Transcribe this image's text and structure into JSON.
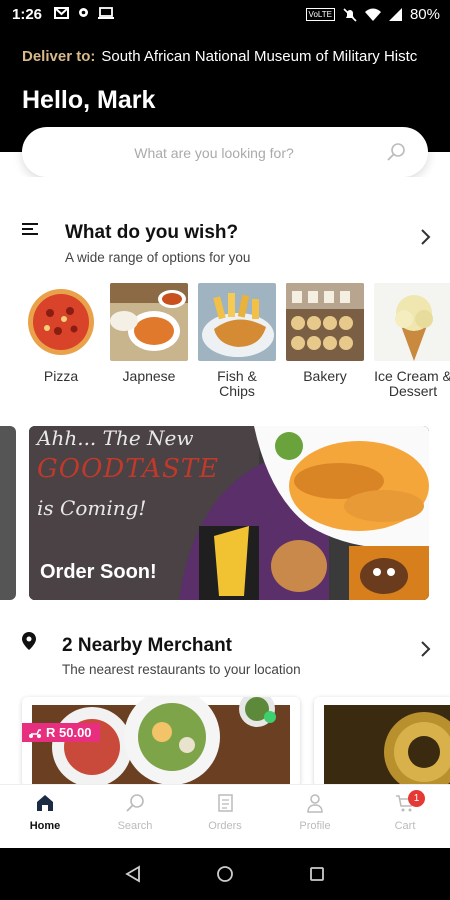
{
  "status_bar": {
    "time": "1:26",
    "volte_label": "VoLTE",
    "battery": "80%"
  },
  "header": {
    "deliver_label": "Deliver to:",
    "deliver_address": "South African National Museum of Military Histc",
    "greeting": "Hello, Mark"
  },
  "search": {
    "placeholder": "What are you looking for?"
  },
  "categories_section": {
    "title": "What do you wish?",
    "subtitle": "A wide range of options for you",
    "items": [
      {
        "label": "Pizza"
      },
      {
        "label": "Japnese"
      },
      {
        "label": "Fish & Chips"
      },
      {
        "label": "Bakery"
      },
      {
        "label": "Ice Cream & Dessert"
      }
    ]
  },
  "banner": {
    "line1": "Ahh... The New",
    "line2": "GOODTASTE",
    "line3": "is Coming!",
    "cta": "Order Soon!"
  },
  "merchants_section": {
    "title": "2 Nearby Merchant",
    "subtitle": "The nearest restaurants to your location",
    "first_price_badge": "R 50.00"
  },
  "bottom_nav": {
    "items": [
      {
        "label": "Home",
        "icon": "home-icon",
        "active": true
      },
      {
        "label": "Search",
        "icon": "search-icon",
        "active": false
      },
      {
        "label": "Orders",
        "icon": "orders-icon",
        "active": false
      },
      {
        "label": "Profile",
        "icon": "profile-icon",
        "active": false
      },
      {
        "label": "Cart",
        "icon": "cart-icon",
        "active": false
      }
    ],
    "cart_count": "1"
  },
  "colors": {
    "accent_gold": "#d8b98a",
    "badge_pink": "#e82e7f",
    "cart_badge_red": "#e53935"
  }
}
